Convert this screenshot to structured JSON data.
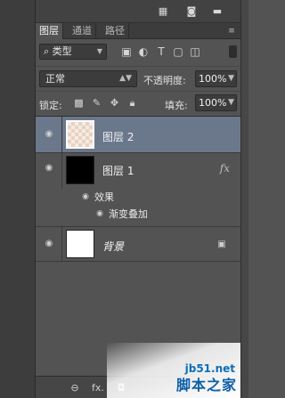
{
  "tabs": [
    {
      "label": "图层",
      "active": true
    },
    {
      "label": "通道",
      "active": false
    },
    {
      "label": "路径",
      "active": false
    }
  ],
  "filter": {
    "kind_label": "类型",
    "search_glyph": "⌕"
  },
  "blend": {
    "mode": "正常",
    "opacity_label": "不透明度:",
    "opacity_value": "100%"
  },
  "lock": {
    "label": "锁定:",
    "fill_label": "填充:",
    "fill_value": "100%"
  },
  "layers": [
    {
      "name": "图层 2",
      "selected": true,
      "thumbnail": "transparent-checker"
    },
    {
      "name": "图层 1",
      "selected": false,
      "thumbnail": "black",
      "fx_label": "fx",
      "effects_label": "效果",
      "effect_name": "渐变叠加"
    },
    {
      "name": "背景",
      "selected": false,
      "thumbnail": "white",
      "locked": true
    }
  ],
  "bottom_bar": {
    "fx_label": "fx."
  },
  "watermark": {
    "url": "jb51.net",
    "name": "脚本之家"
  },
  "colors": {
    "panel_bg": "#535353",
    "selected_row": "#6b778b",
    "watermark_blue": "#0d6fb6"
  }
}
